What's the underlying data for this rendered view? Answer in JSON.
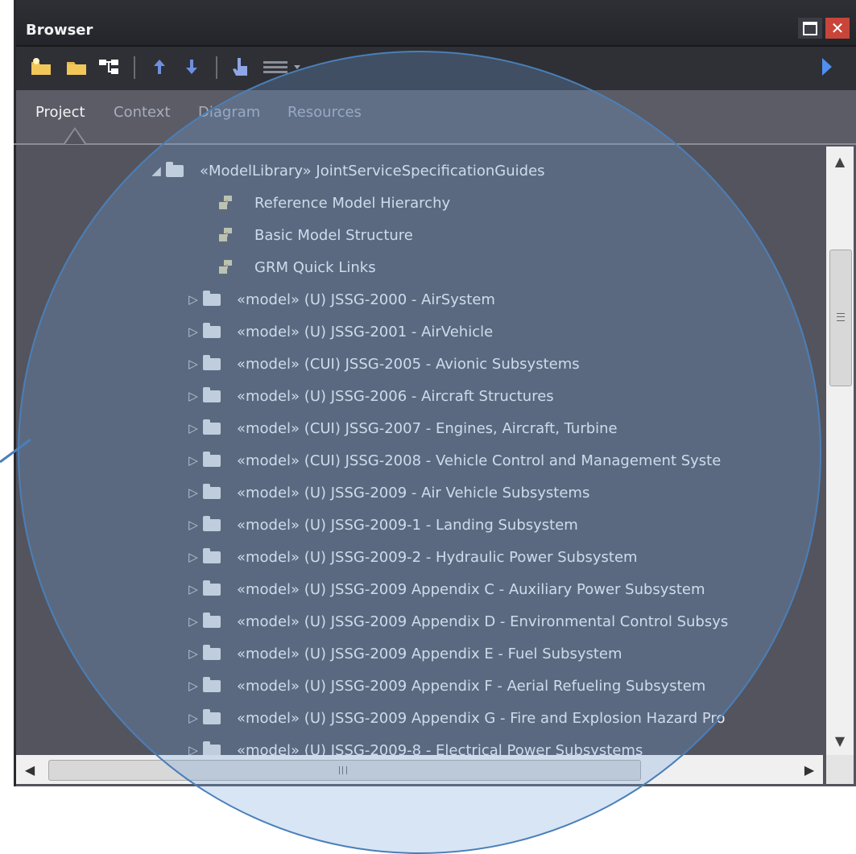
{
  "window": {
    "title": "Browser",
    "maximize_icon": "maximize-icon",
    "close_icon": "close-icon",
    "close_glyph": "✕"
  },
  "toolbar": {
    "icons": [
      "new-folder-icon",
      "folder-icon",
      "hierarchy-icon",
      "move-up-icon",
      "move-down-icon",
      "hand-pointer-icon",
      "menu-lines-icon",
      "dropdown-arrow-icon",
      "overflow-arrow-icon"
    ]
  },
  "tabs": [
    {
      "label": "Project",
      "active": true
    },
    {
      "label": "Context",
      "active": false
    },
    {
      "label": "Diagram",
      "active": false
    },
    {
      "label": "Resources",
      "active": false
    }
  ],
  "tree": {
    "root": {
      "label": "«ModelLibrary» JointServiceSpecificationGuides",
      "expander": "◢",
      "icon": "package-folder-icon"
    },
    "diagrams": [
      {
        "label": "Reference Model Hierarchy",
        "icon": "diagram-icon"
      },
      {
        "label": "Basic Model Structure",
        "icon": "diagram-icon"
      },
      {
        "label": "GRM Quick Links",
        "icon": "diagram-icon"
      }
    ],
    "models": [
      {
        "label": "«model» (U) JSSG-2000 - AirSystem",
        "expander": "▷"
      },
      {
        "label": "«model» (U) JSSG-2001 - AirVehicle",
        "expander": "▷"
      },
      {
        "label": "«model» (CUI) JSSG-2005 - Avionic Subsystems",
        "expander": "▷"
      },
      {
        "label": "«model» (U) JSSG-2006 - Aircraft Structures",
        "expander": "▷"
      },
      {
        "label": "«model» (CUI) JSSG-2007 - Engines, Aircraft, Turbine",
        "expander": "▷"
      },
      {
        "label": "«model» (CUI) JSSG-2008 - Vehicle Control and Management Syste",
        "expander": "▷"
      },
      {
        "label": "«model» (U) JSSG-2009 - Air Vehicle Subsystems",
        "expander": "▷"
      },
      {
        "label": "«model» (U) JSSG-2009-1 - Landing Subsystem",
        "expander": "▷"
      },
      {
        "label": "«model» (U) JSSG-2009-2 - Hydraulic Power Subsystem",
        "expander": "▷"
      },
      {
        "label": "«model» (U) JSSG-2009 Appendix C - Auxiliary Power Subsystem",
        "expander": "▷"
      },
      {
        "label": "«model» (U) JSSG-2009 Appendix D - Environmental Control Subsys",
        "expander": "▷"
      },
      {
        "label": "«model» (U) JSSG-2009 Appendix E - Fuel Subsystem",
        "expander": "▷"
      },
      {
        "label": "«model» (U) JSSG-2009 Appendix F - Aerial Refueling Subsystem",
        "expander": "▷"
      },
      {
        "label": "«model» (U) JSSG-2009 Appendix G - Fire and Explosion Hazard Pro",
        "expander": "▷"
      },
      {
        "label": "«model» (U) JSSG-2009-8 - Electrical Power Subsystems",
        "expander": "▷"
      }
    ]
  },
  "scrollbars": {
    "up": "▲",
    "down": "▼",
    "left": "◀",
    "right": "▶"
  },
  "colors": {
    "panel": "#54545e",
    "titlebar": "#2a2c31",
    "close": "#c9453a",
    "accent": "#4a7fb8",
    "tab_active": "#f4f4f4",
    "tab_inactive": "#a8acbc"
  }
}
